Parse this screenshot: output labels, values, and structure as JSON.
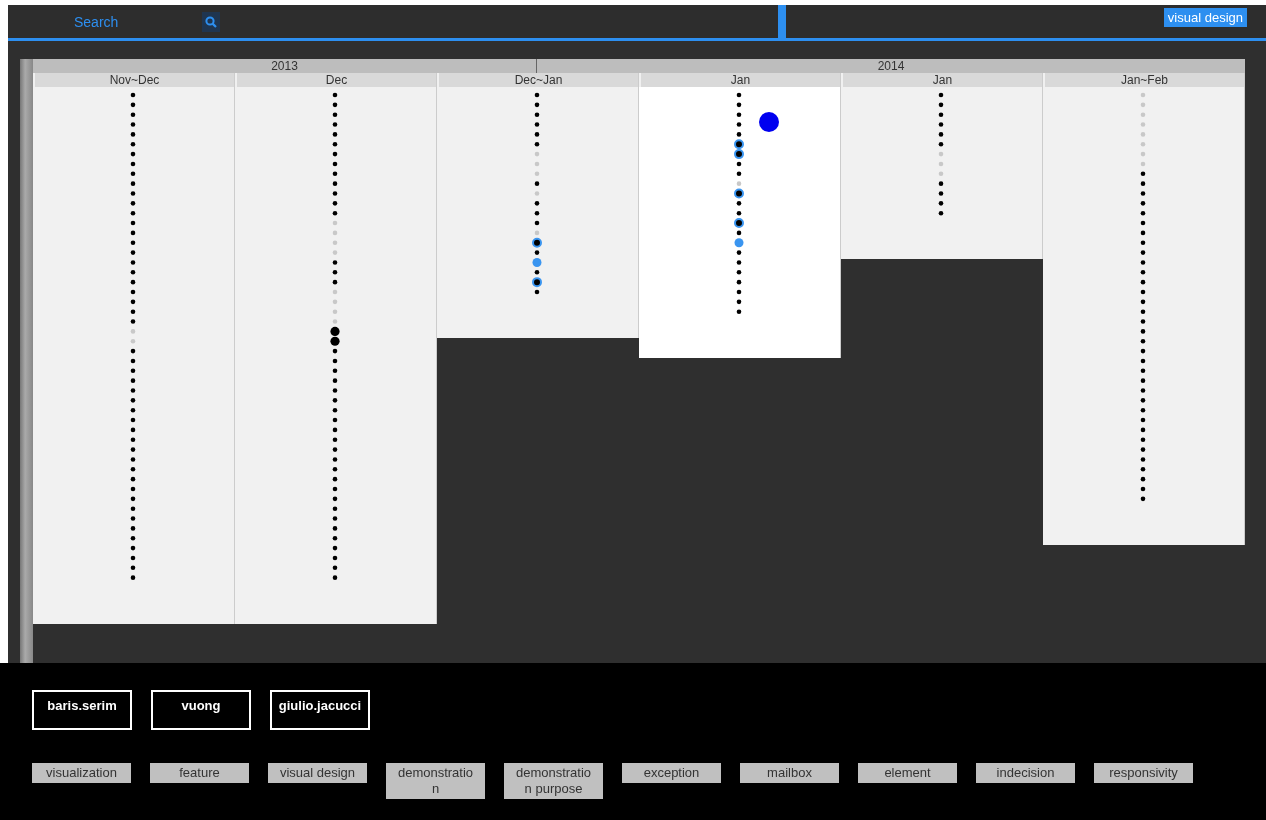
{
  "search": {
    "placeholder": "Search"
  },
  "active_tag": "visual design",
  "years": [
    {
      "label": "2013"
    },
    {
      "label": "2014"
    }
  ],
  "columns": [
    {
      "label": "Nov~Dec",
      "selected": false,
      "marked": false,
      "dots": [
        {
          "kind": "plain"
        },
        {
          "kind": "plain"
        },
        {
          "kind": "plain"
        },
        {
          "kind": "plain"
        },
        {
          "kind": "plain"
        },
        {
          "kind": "plain"
        },
        {
          "kind": "plain"
        },
        {
          "kind": "plain"
        },
        {
          "kind": "plain"
        },
        {
          "kind": "plain"
        },
        {
          "kind": "plain"
        },
        {
          "kind": "plain"
        },
        {
          "kind": "plain"
        },
        {
          "kind": "plain"
        },
        {
          "kind": "plain"
        },
        {
          "kind": "plain"
        },
        {
          "kind": "plain"
        },
        {
          "kind": "plain"
        },
        {
          "kind": "plain"
        },
        {
          "kind": "plain"
        },
        {
          "kind": "plain"
        },
        {
          "kind": "plain"
        },
        {
          "kind": "plain"
        },
        {
          "kind": "plain"
        },
        {
          "kind": "faint"
        },
        {
          "kind": "faint"
        },
        {
          "kind": "plain"
        },
        {
          "kind": "plain"
        },
        {
          "kind": "plain"
        },
        {
          "kind": "plain"
        },
        {
          "kind": "plain"
        },
        {
          "kind": "plain"
        },
        {
          "kind": "plain"
        },
        {
          "kind": "plain"
        },
        {
          "kind": "plain"
        },
        {
          "kind": "plain"
        },
        {
          "kind": "plain"
        },
        {
          "kind": "plain"
        },
        {
          "kind": "plain"
        },
        {
          "kind": "plain"
        },
        {
          "kind": "plain"
        },
        {
          "kind": "plain"
        },
        {
          "kind": "plain"
        },
        {
          "kind": "plain"
        },
        {
          "kind": "plain"
        },
        {
          "kind": "plain"
        },
        {
          "kind": "plain"
        },
        {
          "kind": "plain"
        },
        {
          "kind": "plain"
        },
        {
          "kind": "plain"
        }
      ]
    },
    {
      "label": "Dec",
      "selected": false,
      "marked": false,
      "dots": [
        {
          "kind": "plain"
        },
        {
          "kind": "plain"
        },
        {
          "kind": "plain"
        },
        {
          "kind": "plain"
        },
        {
          "kind": "plain"
        },
        {
          "kind": "plain"
        },
        {
          "kind": "plain"
        },
        {
          "kind": "plain"
        },
        {
          "kind": "plain"
        },
        {
          "kind": "plain"
        },
        {
          "kind": "plain"
        },
        {
          "kind": "plain"
        },
        {
          "kind": "plain"
        },
        {
          "kind": "faint"
        },
        {
          "kind": "faint"
        },
        {
          "kind": "faint"
        },
        {
          "kind": "faint"
        },
        {
          "kind": "plain"
        },
        {
          "kind": "plain"
        },
        {
          "kind": "plain"
        },
        {
          "kind": "faint"
        },
        {
          "kind": "faint"
        },
        {
          "kind": "faint"
        },
        {
          "kind": "faint"
        },
        {
          "kind": "large"
        },
        {
          "kind": "large"
        },
        {
          "kind": "plain"
        },
        {
          "kind": "plain"
        },
        {
          "kind": "plain"
        },
        {
          "kind": "plain"
        },
        {
          "kind": "plain"
        },
        {
          "kind": "plain"
        },
        {
          "kind": "plain"
        },
        {
          "kind": "plain"
        },
        {
          "kind": "plain"
        },
        {
          "kind": "plain"
        },
        {
          "kind": "plain"
        },
        {
          "kind": "plain"
        },
        {
          "kind": "plain"
        },
        {
          "kind": "plain"
        },
        {
          "kind": "plain"
        },
        {
          "kind": "plain"
        },
        {
          "kind": "plain"
        },
        {
          "kind": "plain"
        },
        {
          "kind": "plain"
        },
        {
          "kind": "plain"
        },
        {
          "kind": "plain"
        },
        {
          "kind": "plain"
        },
        {
          "kind": "plain"
        },
        {
          "kind": "plain"
        }
      ]
    },
    {
      "label": "Dec~Jan",
      "selected": false,
      "marked": false,
      "dots": [
        {
          "kind": "plain"
        },
        {
          "kind": "plain"
        },
        {
          "kind": "plain"
        },
        {
          "kind": "plain"
        },
        {
          "kind": "plain"
        },
        {
          "kind": "plain"
        },
        {
          "kind": "faint"
        },
        {
          "kind": "faint"
        },
        {
          "kind": "faint"
        },
        {
          "kind": "plain"
        },
        {
          "kind": "faint"
        },
        {
          "kind": "plain"
        },
        {
          "kind": "plain"
        },
        {
          "kind": "plain"
        },
        {
          "kind": "faint"
        },
        {
          "kind": "ringed"
        },
        {
          "kind": "plain"
        },
        {
          "kind": "blue"
        },
        {
          "kind": "plain"
        },
        {
          "kind": "ringed"
        },
        {
          "kind": "plain"
        }
      ]
    },
    {
      "label": "Jan",
      "selected": true,
      "marked": true,
      "dots": [
        {
          "kind": "plain"
        },
        {
          "kind": "plain"
        },
        {
          "kind": "plain"
        },
        {
          "kind": "plain"
        },
        {
          "kind": "plain"
        },
        {
          "kind": "ringed"
        },
        {
          "kind": "ringed"
        },
        {
          "kind": "plain"
        },
        {
          "kind": "plain"
        },
        {
          "kind": "faint"
        },
        {
          "kind": "ringed"
        },
        {
          "kind": "plain"
        },
        {
          "kind": "plain"
        },
        {
          "kind": "ringed"
        },
        {
          "kind": "plain"
        },
        {
          "kind": "blue"
        },
        {
          "kind": "plain"
        },
        {
          "kind": "plain"
        },
        {
          "kind": "plain"
        },
        {
          "kind": "plain"
        },
        {
          "kind": "plain"
        },
        {
          "kind": "plain"
        },
        {
          "kind": "plain"
        }
      ]
    },
    {
      "label": "Jan",
      "selected": false,
      "marked": false,
      "dots": [
        {
          "kind": "plain"
        },
        {
          "kind": "plain"
        },
        {
          "kind": "plain"
        },
        {
          "kind": "plain"
        },
        {
          "kind": "plain"
        },
        {
          "kind": "plain"
        },
        {
          "kind": "faint"
        },
        {
          "kind": "faint"
        },
        {
          "kind": "faint"
        },
        {
          "kind": "plain"
        },
        {
          "kind": "plain"
        },
        {
          "kind": "plain"
        },
        {
          "kind": "plain"
        }
      ]
    },
    {
      "label": "Jan~Feb",
      "selected": false,
      "marked": false,
      "dots": [
        {
          "kind": "faint"
        },
        {
          "kind": "faint"
        },
        {
          "kind": "faint"
        },
        {
          "kind": "faint"
        },
        {
          "kind": "faint"
        },
        {
          "kind": "faint"
        },
        {
          "kind": "faint"
        },
        {
          "kind": "faint"
        },
        {
          "kind": "plain"
        },
        {
          "kind": "plain"
        },
        {
          "kind": "plain"
        },
        {
          "kind": "plain"
        },
        {
          "kind": "plain"
        },
        {
          "kind": "plain"
        },
        {
          "kind": "plain"
        },
        {
          "kind": "plain"
        },
        {
          "kind": "plain"
        },
        {
          "kind": "plain"
        },
        {
          "kind": "plain"
        },
        {
          "kind": "plain"
        },
        {
          "kind": "plain"
        },
        {
          "kind": "plain"
        },
        {
          "kind": "plain"
        },
        {
          "kind": "plain"
        },
        {
          "kind": "plain"
        },
        {
          "kind": "plain"
        },
        {
          "kind": "plain"
        },
        {
          "kind": "plain"
        },
        {
          "kind": "plain"
        },
        {
          "kind": "plain"
        },
        {
          "kind": "plain"
        },
        {
          "kind": "plain"
        },
        {
          "kind": "plain"
        },
        {
          "kind": "plain"
        },
        {
          "kind": "plain"
        },
        {
          "kind": "plain"
        },
        {
          "kind": "plain"
        },
        {
          "kind": "plain"
        },
        {
          "kind": "plain"
        },
        {
          "kind": "plain"
        },
        {
          "kind": "plain"
        },
        {
          "kind": "plain"
        }
      ]
    }
  ],
  "users": [
    "baris.serim",
    "vuong",
    "giulio.jacucci"
  ],
  "tags": [
    "visualization",
    "feature",
    "visual design",
    "demonstration",
    "demonstration purpose",
    "exception",
    "mailbox",
    "element",
    "indecision",
    "responsivity"
  ]
}
